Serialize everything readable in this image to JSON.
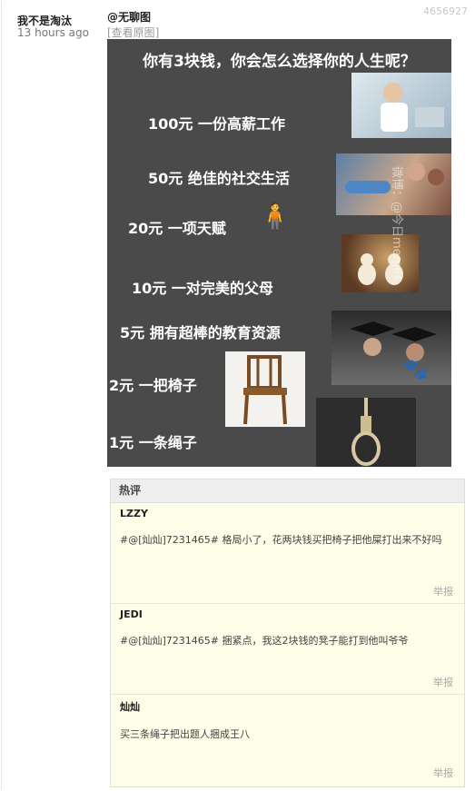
{
  "post": {
    "author": "我不是淘汰",
    "time": "13 hours ago",
    "id": "4656927",
    "tag": "@无聊图",
    "view_original": "[查看原图]"
  },
  "meme": {
    "title": "你有3块钱，你会怎么选择你的人生呢？",
    "options": [
      "100元  一份高薪工作",
      "50元 绝佳的社交生活",
      "20元 一项天赋",
      "10元 一对完美的父母",
      "5元  拥有超棒的教育资源",
      "2元  一把椅子",
      "1元  一条绳子"
    ],
    "watermark": "微博：@今日memes"
  },
  "comments": {
    "header": "热评",
    "report_label": "举报",
    "items": [
      {
        "author": "LZZY",
        "text": "#@[灿灿]7231465# 格局小了，花两块钱买把椅子把他屎打出来不好吗"
      },
      {
        "author": "JEDI",
        "text": "#@[灿灿]7231465# 捆紧点，我这2块钱的凳子能打到他叫爷爷"
      },
      {
        "author": "灿灿",
        "text": "买三条绳子把出题人捆成王八"
      }
    ]
  }
}
